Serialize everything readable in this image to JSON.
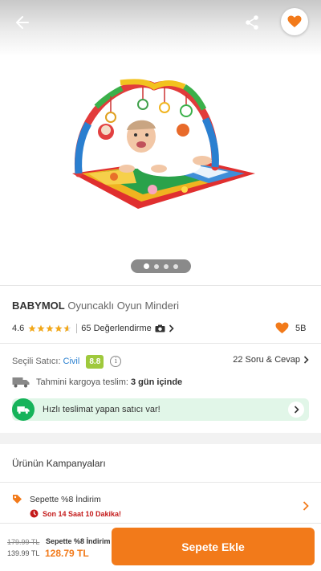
{
  "colors": {
    "accent": "#f27a1a",
    "seller_link": "#2a80d0",
    "score_badge": "#9fc93c",
    "fast_green": "#16b35a",
    "timer_red": "#c41a1a"
  },
  "header": {
    "back_icon": "arrow-left-icon",
    "share_icon": "share-icon",
    "favorite_icon": "heart-icon"
  },
  "gallery": {
    "image_alt": "BABYMOL Oyuncaklı Oyun Minderi",
    "page_count": 4,
    "active_page": 1
  },
  "product": {
    "brand": "BABYMOL",
    "name": "Oyuncaklı Oyun Minderi",
    "rating": "4.6",
    "rating_value": 4.6,
    "reviews": "65 Değerlendirme",
    "likes": "5B"
  },
  "seller": {
    "label": "Seçili Satıcı:",
    "name": "Civil",
    "score": "8.8",
    "qa_label": "22 Soru & Cevap"
  },
  "shipping": {
    "label": "Tahmini kargoya teslim:",
    "value": "3 gün içinde"
  },
  "fast_delivery": {
    "text": "Hızlı teslimat yapan satıcı var!"
  },
  "campaigns": {
    "title": "Ürünün Kampanyaları",
    "items": [
      {
        "label": "Sepette %8 İndirim",
        "timer": "Son 14 Saat 10 Dakika!"
      }
    ]
  },
  "bottom_bar": {
    "old_price": "179.99 TL",
    "mid_price": "139.99 TL",
    "campaign": "Sepette %8 İndirim",
    "final_price": "128.79 TL",
    "add_to_cart": "Sepete Ekle"
  }
}
